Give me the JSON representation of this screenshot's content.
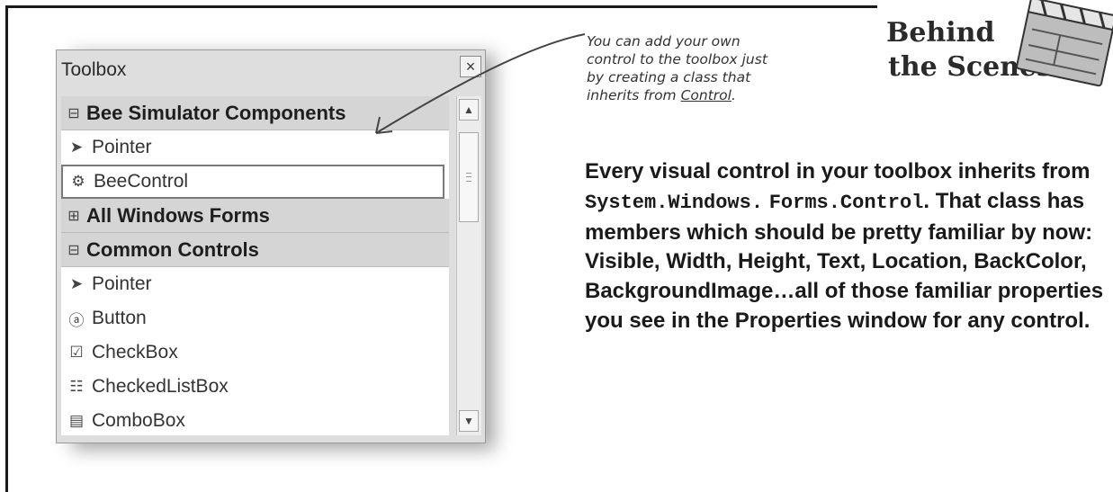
{
  "toolbox": {
    "title": "Toolbox",
    "close_label": "×",
    "rows": [
      {
        "type": "category",
        "glyph": "⊟",
        "label": "Bee Simulator Components"
      },
      {
        "type": "item",
        "glyph": "➤",
        "label": "Pointer"
      },
      {
        "type": "item-selected",
        "glyph": "⚙",
        "label": "BeeControl"
      },
      {
        "type": "category",
        "glyph": "⊞",
        "label": "All Windows Forms"
      },
      {
        "type": "category",
        "glyph": "⊟",
        "label": "Common Controls"
      },
      {
        "type": "item",
        "glyph": "➤",
        "label": "Pointer"
      },
      {
        "type": "item",
        "glyph": "ⓐ",
        "label": "Button"
      },
      {
        "type": "item",
        "glyph": "☑",
        "label": "CheckBox"
      },
      {
        "type": "item",
        "glyph": "☷",
        "label": "CheckedListBox"
      },
      {
        "type": "item",
        "glyph": "▤",
        "label": "ComboBox"
      }
    ],
    "scroll_up": "▲",
    "scroll_down": "▼"
  },
  "note": {
    "line1": "You can add your own",
    "line2": "control to the toolbox just",
    "line3": "by creating a class that",
    "line4_prefix": "inherits from ",
    "line4_link": "Control",
    "line4_suffix": "."
  },
  "heading": {
    "line1": "Behind",
    "line2": "the Scenes"
  },
  "body": {
    "part1": "Every visual control in your toolbox inherits from ",
    "code1": "System.Windows.",
    "code2": "Forms.Control",
    "part2": ". That class has members which should be pretty familiar by now: Visible, Width, Height, Text, Location, BackColor, BackgroundImage…all of those familiar properties you see in the Properties window for any control."
  }
}
